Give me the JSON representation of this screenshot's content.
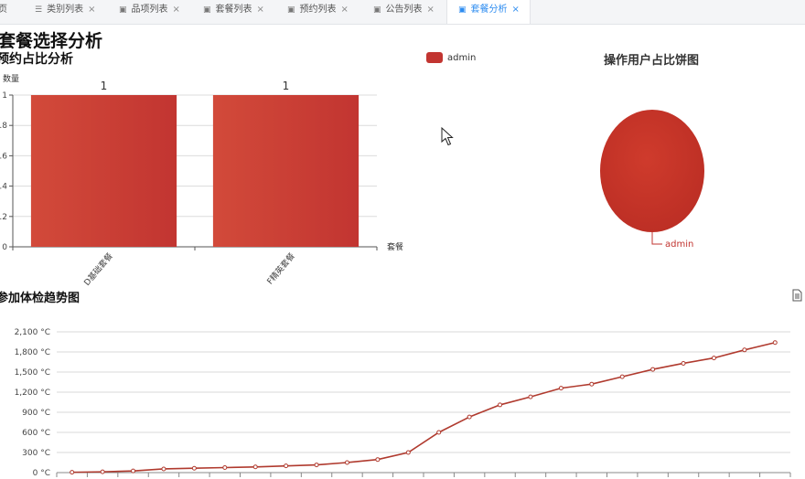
{
  "tabs": [
    {
      "label": "页",
      "icon": "",
      "closable": false,
      "active": false
    },
    {
      "label": "类别列表",
      "icon": "list-icon",
      "closable": true,
      "active": false
    },
    {
      "label": "品项列表",
      "icon": "image-icon",
      "closable": true,
      "active": false
    },
    {
      "label": "套餐列表",
      "icon": "image-icon",
      "closable": true,
      "active": false
    },
    {
      "label": "预约列表",
      "icon": "image-icon",
      "closable": true,
      "active": false
    },
    {
      "label": "公告列表",
      "icon": "image-icon",
      "closable": true,
      "active": false
    },
    {
      "label": "套餐分析",
      "icon": "image-icon",
      "closable": true,
      "active": true
    }
  ],
  "page": {
    "title": "套餐选择分析"
  },
  "colors": {
    "accent": "#c23531",
    "line": "#b03a2e",
    "tab_active": "#2d8cf0"
  },
  "chart_data": [
    {
      "type": "bar",
      "title": "预约占比分析",
      "ylabel": "数量",
      "xlabel": "套餐",
      "categories": [
        "D基础套餐",
        "F精英套餐"
      ],
      "values": [
        1,
        1
      ],
      "data_labels": [
        "1",
        "1"
      ],
      "ylim": [
        0,
        1
      ],
      "yticks": [
        0,
        0.2,
        0.4,
        0.6,
        0.8,
        1
      ],
      "ytick_labels": [
        "0",
        ".2",
        ".4",
        ".6",
        ".8",
        "1"
      ],
      "grid": true
    },
    {
      "type": "pie",
      "title": "操作用户占比饼图",
      "legend": [
        "admin"
      ],
      "legend_position": "top-left",
      "slices": [
        {
          "name": "admin",
          "value": 1
        }
      ],
      "labels": [
        "admin"
      ]
    },
    {
      "type": "line",
      "title": "参加体检趋势图",
      "ylim": [
        0,
        2100
      ],
      "yticks": [
        0,
        300,
        600,
        900,
        1200,
        1500,
        1800,
        2100
      ],
      "ytick_labels": [
        "0 °C",
        "300 °C",
        "600 °C",
        "900 °C",
        "1,200 °C",
        "1,500 °C",
        "1,800 °C",
        "2,100 °C"
      ],
      "values": [
        5,
        12,
        25,
        55,
        65,
        75,
        85,
        100,
        115,
        150,
        195,
        300,
        600,
        830,
        1010,
        1130,
        1260,
        1320,
        1430,
        1540,
        1630,
        1710,
        1830,
        1940
      ],
      "grid": true
    }
  ]
}
